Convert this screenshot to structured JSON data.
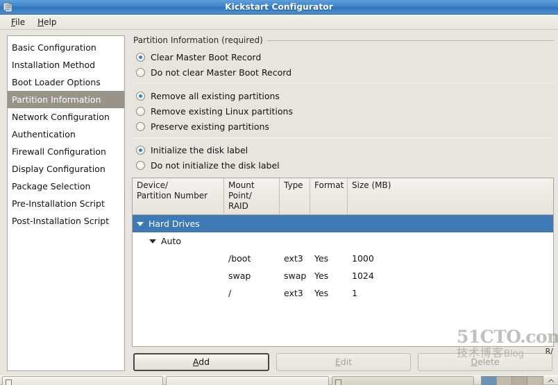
{
  "window": {
    "title": "Kickstart Configurator",
    "icon": "app-icon"
  },
  "menubar": {
    "items": [
      {
        "label": "File",
        "mnemonic": "F"
      },
      {
        "label": "Help",
        "mnemonic": "H"
      }
    ]
  },
  "sidebar": {
    "items": [
      {
        "label": "Basic Configuration",
        "selected": false
      },
      {
        "label": "Installation Method",
        "selected": false
      },
      {
        "label": "Boot Loader Options",
        "selected": false
      },
      {
        "label": "Partition Information",
        "selected": true
      },
      {
        "label": "Network Configuration",
        "selected": false
      },
      {
        "label": "Authentication",
        "selected": false
      },
      {
        "label": "Firewall Configuration",
        "selected": false
      },
      {
        "label": "Display Configuration",
        "selected": false
      },
      {
        "label": "Package Selection",
        "selected": false
      },
      {
        "label": "Pre-Installation Script",
        "selected": false
      },
      {
        "label": "Post-Installation Script",
        "selected": false
      }
    ]
  },
  "main": {
    "group_title": "Partition Information (required)",
    "radio_groups": [
      {
        "name": "mbr",
        "options": [
          {
            "label": "Clear Master Boot Record",
            "selected": true
          },
          {
            "label": "Do not clear Master Boot Record",
            "selected": false
          }
        ]
      },
      {
        "name": "partitions",
        "options": [
          {
            "label": "Remove all existing partitions",
            "selected": true
          },
          {
            "label": "Remove existing Linux partitions",
            "selected": false
          },
          {
            "label": "Preserve existing partitions",
            "selected": false
          }
        ]
      },
      {
        "name": "disklabel",
        "options": [
          {
            "label": "Initialize the disk label",
            "selected": true
          },
          {
            "label": "Do not initialize the disk label",
            "selected": false
          }
        ]
      }
    ],
    "table": {
      "columns": [
        "Device/\nPartition Number",
        "Mount Point/\nRAID",
        "Type",
        "Format",
        "Size (MB)"
      ],
      "rows": [
        {
          "kind": "group",
          "indent": 0,
          "expander": "expanded",
          "selected": true,
          "device": "Hard Drives",
          "mount": "",
          "type": "",
          "format": "",
          "size": ""
        },
        {
          "kind": "group",
          "indent": 1,
          "expander": "expanded",
          "selected": false,
          "device": "Auto",
          "mount": "",
          "type": "",
          "format": "",
          "size": ""
        },
        {
          "kind": "leaf",
          "indent": 2,
          "expander": "none",
          "selected": false,
          "device": "",
          "mount": "/boot",
          "type": "ext3",
          "format": "Yes",
          "size": "1000"
        },
        {
          "kind": "leaf",
          "indent": 2,
          "expander": "none",
          "selected": false,
          "device": "",
          "mount": "swap",
          "type": "swap",
          "format": "Yes",
          "size": "1024"
        },
        {
          "kind": "leaf",
          "indent": 2,
          "expander": "none",
          "selected": false,
          "device": "",
          "mount": "/",
          "type": "ext3",
          "format": "Yes",
          "size": "1"
        }
      ]
    },
    "buttons": [
      {
        "label": "Add",
        "mnemonic": "A",
        "state": "focused"
      },
      {
        "label": "Edit",
        "mnemonic": "E",
        "state": "disabled"
      },
      {
        "label": "Delete",
        "mnemonic": "D",
        "state": "disabled"
      }
    ]
  },
  "watermark": {
    "line1": "51CTO.com",
    "line2": "技术博客",
    "line2_suffix": "Blog",
    "corner_text": "R/"
  },
  "colors": {
    "titlebar": "#3f84c8",
    "selection_tree": "#3d7ab5",
    "selection_sidebar": "#9a9389",
    "radio_dot": "#3a7fbf",
    "panel_bg": "#e8e5de"
  }
}
